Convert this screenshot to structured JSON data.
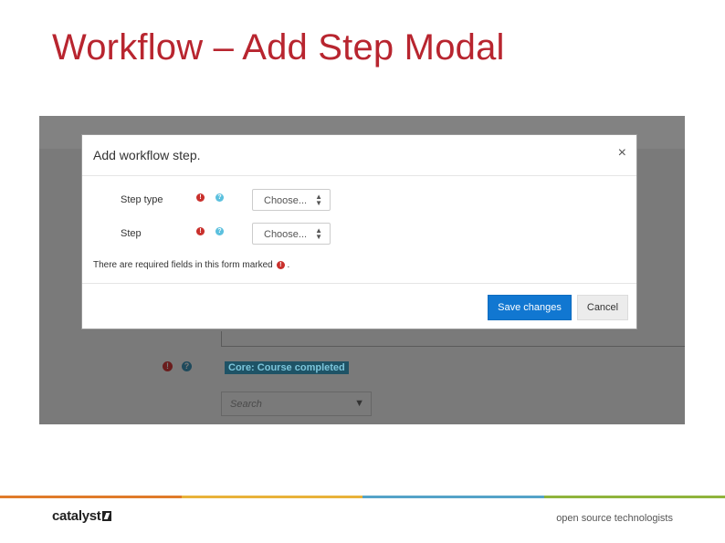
{
  "slide": {
    "title": "Workflow – Add Step Modal"
  },
  "background_form": {
    "tag_label": "Core: Course completed",
    "search_placeholder": "Search",
    "search_caret": "▼",
    "error_icon": "!",
    "help_icon": "?"
  },
  "modal": {
    "title": "Add workflow step.",
    "close_glyph": "×",
    "fields": [
      {
        "label": "Step type",
        "value": "Choose...",
        "required_icon": "!",
        "help_icon": "?"
      },
      {
        "label": "Step",
        "value": "Choose...",
        "required_icon": "!",
        "help_icon": "?"
      }
    ],
    "required_note": "There are required fields in this form marked",
    "required_note_icon": "!",
    "required_note_end": ".",
    "save_label": "Save changes",
    "cancel_label": "Cancel",
    "select_arrows": "▲▼"
  },
  "footer": {
    "logo_text": "catalyst",
    "tagline": "open source technologists",
    "stripe_colors": [
      "#e07b2a",
      "#e8b23a",
      "#55a3c8",
      "#8fb43c"
    ]
  },
  "colors": {
    "title_red": "#b8252f",
    "primary_blue": "#1177d1",
    "required_red": "#c9302c",
    "help_blue": "#5bc0de"
  }
}
